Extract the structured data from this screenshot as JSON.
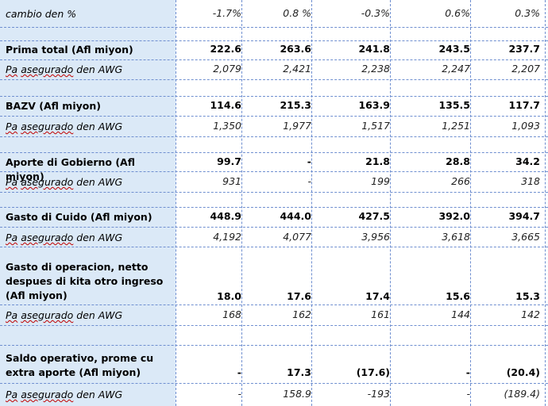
{
  "rows": [
    {
      "label": "cambio den %",
      "style": "it",
      "values": [
        "-1.7%",
        "0.8 %",
        "-0.3%",
        "0.6%",
        "0.3%"
      ]
    },
    {
      "label": "Prima total (Afl miyon)",
      "style": "bold",
      "values": [
        "222.6",
        "263.6",
        "241.8",
        "243.5",
        "237.7"
      ]
    },
    {
      "label": "Pa asegurado den AWG",
      "style": "it",
      "values": [
        "2,079",
        "2,421",
        "2,238",
        "2,247",
        "2,207"
      ]
    },
    {
      "label": "BAZV (Afl miyon)",
      "style": "bold",
      "values": [
        "114.6",
        "215.3",
        "163.9",
        "135.5",
        "117.7"
      ]
    },
    {
      "label": "Pa asegurado den AWG",
      "style": "it",
      "values": [
        "1,350",
        "1,977",
        "1,517",
        "1,251",
        "1,093"
      ]
    },
    {
      "label": "Aporte di Gobierno (Afl miyon)",
      "style": "bold",
      "values": [
        "99.7",
        "-",
        "21.8",
        "28.8",
        "34.2"
      ]
    },
    {
      "label": "Pa asegurado den AWG",
      "style": "it",
      "values": [
        "931",
        "-",
        "199",
        "266",
        "318"
      ]
    },
    {
      "label": "Gasto di Cuido (Afl miyon)",
      "style": "bold",
      "values": [
        "448.9",
        "444.0",
        "427.5",
        "392.0",
        "394.7"
      ]
    },
    {
      "label": "Pa asegurado den AWG",
      "style": "it",
      "values": [
        "4,192",
        "4,077",
        "3,956",
        "3,618",
        "3,665"
      ]
    },
    {
      "label": "Gasto di operacion, netto despues di kita otro ingreso (Afl miyon)",
      "style": "bold",
      "values": [
        "18.0",
        "17.6",
        "17.4",
        "15.6",
        "15.3"
      ]
    },
    {
      "label": "Pa asegurado den AWG",
      "style": "it",
      "values": [
        "168",
        "162",
        "161",
        "144",
        "142"
      ]
    },
    {
      "label": "Saldo operativo, prome cu extra aporte (Afl miyon)",
      "style": "bold",
      "values": [
        "-",
        "17.3",
        "(17.6)",
        "-",
        "(20.4)"
      ]
    },
    {
      "label": "Pa asegurado den AWG",
      "style": "it",
      "values": [
        "-",
        "158.9",
        "-193",
        "-",
        "(189.4)"
      ]
    }
  ]
}
